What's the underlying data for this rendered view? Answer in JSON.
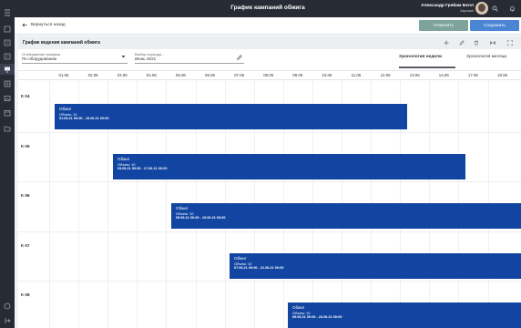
{
  "header": {
    "title": "График кампаний обжига",
    "user_name": "Александр Грейам Белл",
    "user_role": "Заргазин"
  },
  "actions": {
    "back_label": "Вернуться назад",
    "cancel_label": "Отменить",
    "save_label": "Сохранить"
  },
  "panel": {
    "title": "График ведения кампаний обжига",
    "display_label": "Отображение графика",
    "display_value": "По оборудованию",
    "period_label": "Выбор периода...",
    "period_value": "Июнь 2021",
    "tabs": [
      "Хронология недели",
      "Хронология месяца"
    ]
  },
  "dates": [
    "01.06",
    "02.06",
    "03.06",
    "04.06",
    "05.06",
    "06.06",
    "07.06",
    "08.06",
    "09.06",
    "10.06",
    "11.06",
    "12.06",
    "13.06",
    "14.06",
    "17.06",
    "18.06"
  ],
  "rows": [
    {
      "label": "К 04",
      "title": "Обжиг",
      "volume": "Объем: 10",
      "range": "01.06.21 00:00 - 15.06.21 00:00"
    },
    {
      "label": "К 05",
      "title": "Обжиг",
      "volume": "Объем: 10",
      "range": "03.06.21 00:00 - 17.06.21 00:00"
    },
    {
      "label": "К 06",
      "title": "Обжиг",
      "volume": "Объем: 10",
      "range": "05.06.21 00:00 - 19.06.21 00:00"
    },
    {
      "label": "К 07",
      "title": "Обжиг",
      "volume": "Объем: 10",
      "range": "07.06.21 00:00 - 21.06.21 00:00"
    },
    {
      "label": "К 08",
      "title": "Обжиг",
      "volume": "Объем: 10",
      "range": "09.06.21 00:00 - 23.06.21 00:00"
    }
  ],
  "colors": {
    "bar": "#1145a1",
    "cancel": "#7ea39d",
    "save": "#4b86d4",
    "topbar": "#272b33"
  }
}
